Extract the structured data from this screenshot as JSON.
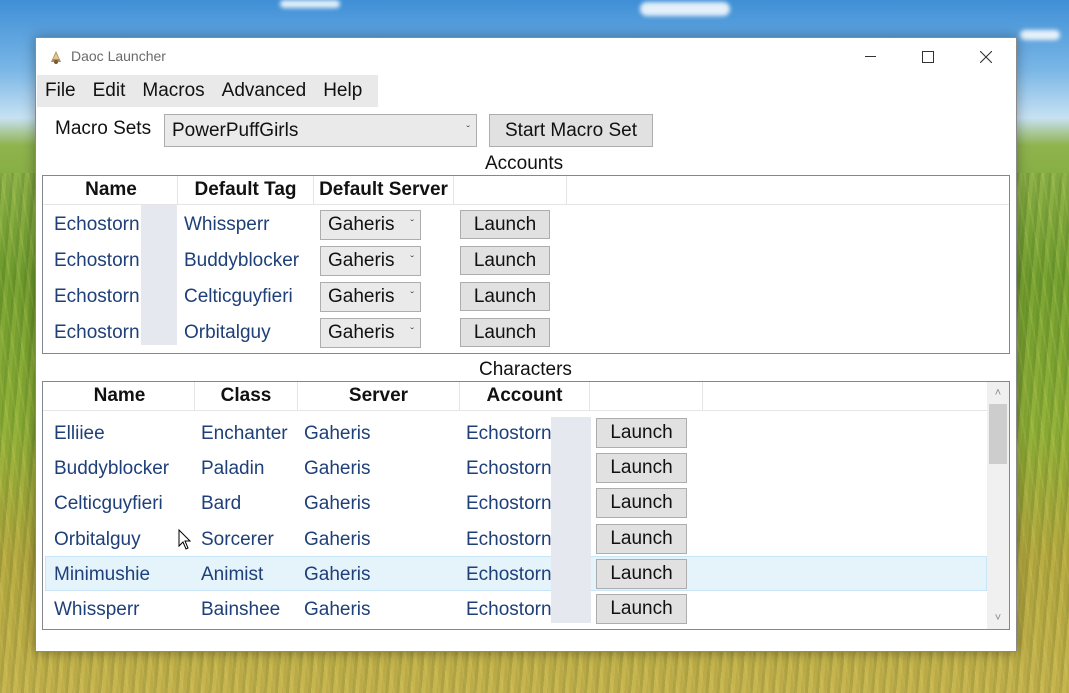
{
  "window": {
    "title": "Daoc Launcher"
  },
  "menu": [
    "File",
    "Edit",
    "Macros",
    "Advanced",
    "Help"
  ],
  "macro_sets": {
    "label": "Macro Sets",
    "selected": "PowerPuffGirls",
    "start_button": "Start Macro Set"
  },
  "accounts": {
    "title": "Accounts",
    "headers": [
      "Name",
      "Default Tag",
      "Default Server"
    ],
    "rows": [
      {
        "name": "Echostorn",
        "tag": "Whissperr",
        "server": "Gaheris",
        "action": "Launch"
      },
      {
        "name": "Echostorn",
        "tag": "Buddyblocker",
        "server": "Gaheris",
        "action": "Launch"
      },
      {
        "name": "Echostorn",
        "tag": "Celticguyfieri",
        "server": "Gaheris",
        "action": "Launch"
      },
      {
        "name": "Echostorn",
        "tag": "Orbitalguy",
        "server": "Gaheris",
        "action": "Launch"
      }
    ]
  },
  "characters": {
    "title": "Characters",
    "headers": [
      "Name",
      "Class",
      "Server",
      "Account"
    ],
    "rows": [
      {
        "name": "Elliiee",
        "class": "Enchanter",
        "server": "Gaheris",
        "account": "Echostorn",
        "action": "Launch"
      },
      {
        "name": "Buddyblocker",
        "class": "Paladin",
        "server": "Gaheris",
        "account": "Echostorn",
        "action": "Launch"
      },
      {
        "name": "Celticguyfieri",
        "class": "Bard",
        "server": "Gaheris",
        "account": "Echostorn",
        "action": "Launch"
      },
      {
        "name": "Orbitalguy",
        "class": "Sorcerer",
        "server": "Gaheris",
        "account": "Echostorn",
        "action": "Launch"
      },
      {
        "name": "Minimushie",
        "class": "Animist",
        "server": "Gaheris",
        "account": "Echostorn",
        "action": "Launch"
      },
      {
        "name": "Whissperr",
        "class": "Bainshee",
        "server": "Gaheris",
        "account": "Echostorn",
        "action": "Launch"
      }
    ],
    "hovered_row": 4
  }
}
